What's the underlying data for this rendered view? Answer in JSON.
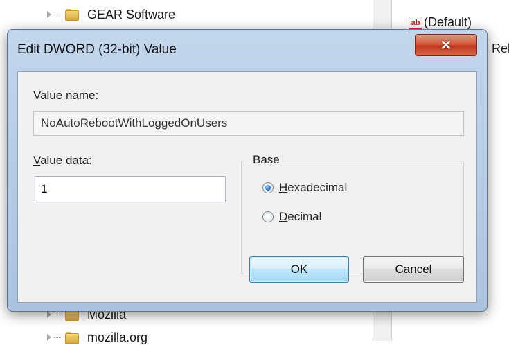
{
  "background": {
    "tree_items": [
      {
        "label": "GEAR Software"
      },
      {
        "label": "Mozilla"
      },
      {
        "label": "mozilla.org"
      }
    ],
    "values_pane": {
      "default_value_label": "(Default)",
      "peek_label": "Rel"
    }
  },
  "dialog": {
    "title": "Edit DWORD (32-bit) Value",
    "close_glyph": "✕",
    "value_name_label_pre": "Value ",
    "value_name_label_accel": "n",
    "value_name_label_post": "ame:",
    "value_name": "NoAutoRebootWithLoggedOnUsers",
    "value_data_label_accel": "V",
    "value_data_label_post": "alue data:",
    "value_data": "1",
    "base_label": "Base",
    "base_options": [
      {
        "accel": "H",
        "rest": "exadecimal",
        "checked": true
      },
      {
        "accel": "D",
        "rest": "ecimal",
        "checked": false
      }
    ],
    "ok_label": "OK",
    "cancel_label": "Cancel"
  },
  "colors": {
    "title_bar": "#b5cbe4",
    "close_button": "#c8432a",
    "ok_border": "#3c7fb1",
    "client_bg": "#f0f0f0"
  }
}
